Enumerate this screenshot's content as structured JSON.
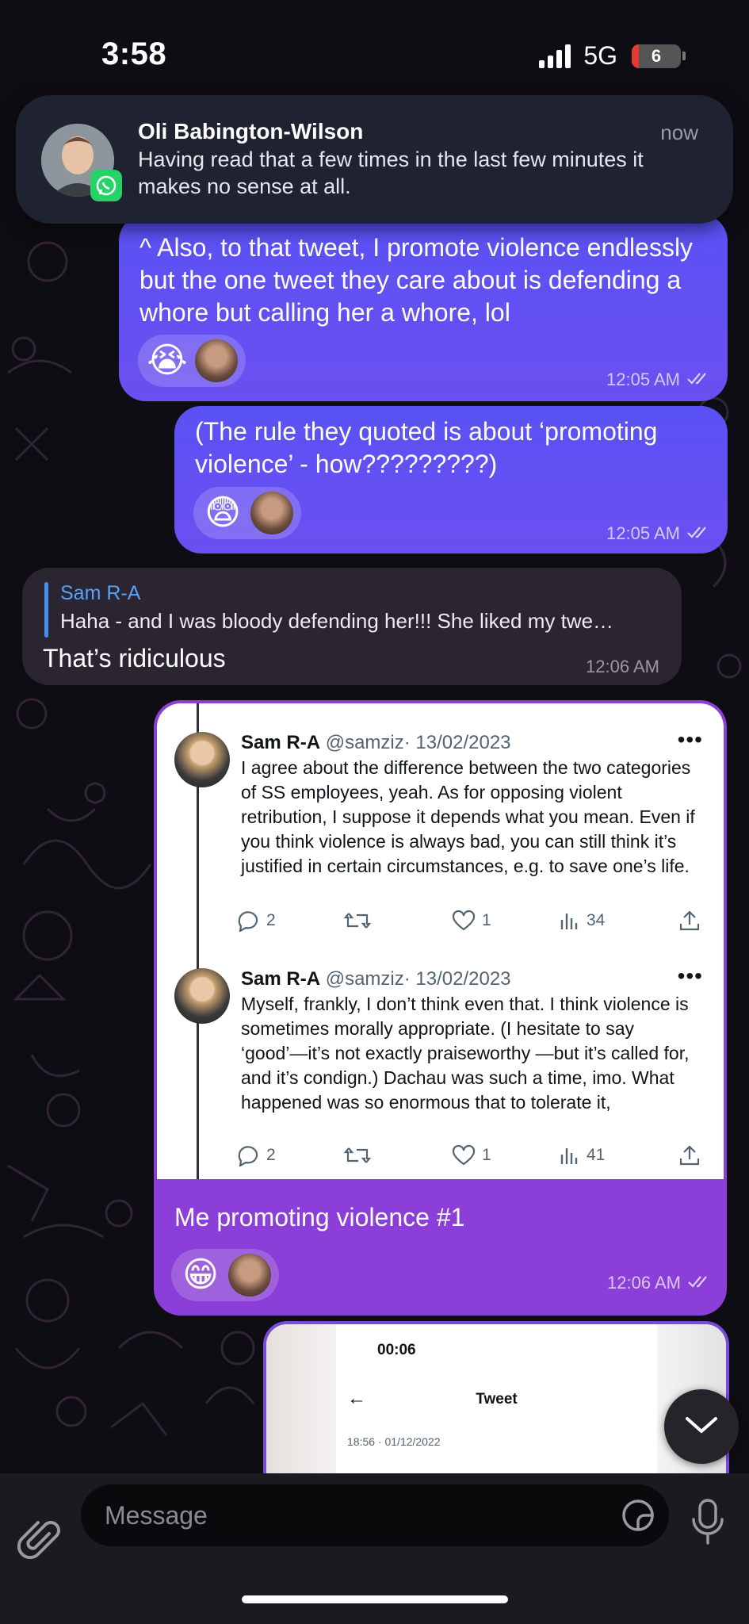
{
  "status_bar": {
    "time": "3:58",
    "network": "5G",
    "battery_percent": "6",
    "signal_bars": 4
  },
  "notification": {
    "sender": "Oli Babington-Wilson",
    "time": "now",
    "message": "Having read that a few times in the last few minutes it makes no sense at all.",
    "app_badge": "whatsapp-icon"
  },
  "messages": [
    {
      "type": "outgoing",
      "text": "^ Also, to that tweet, I promote violence endlessly but the one tweet they care about is defending a whore but calling her a whore, lol",
      "reaction": "😭",
      "time": "12:05 AM"
    },
    {
      "type": "outgoing",
      "text": "(The rule they quoted is about ‘promoting violence’ - how?????????)",
      "reaction": "😨",
      "time": "12:05 AM"
    },
    {
      "type": "incoming",
      "reply_to_name": "Sam R-A",
      "reply_to_text": "Haha - and I was bloody defending her!!! She liked my twe…",
      "text": "That’s ridiculous",
      "time": "12:06 AM"
    },
    {
      "type": "outgoing-image",
      "caption": "Me promoting violence #1",
      "reaction": "😁",
      "time": "12:06 AM",
      "tweets": [
        {
          "name": "Sam R-A",
          "handle": "@samziz",
          "date": "· 13/02/2023",
          "text": "I agree about the difference between the two categories of SS employees, yeah. As for opposing violent retribution, I suppose it depends what you mean. Even if you think violence is always bad, you can still think it’s justified in certain circumstances, e.g. to save one’s life.",
          "replies": "2",
          "likes": "1",
          "views": "34"
        },
        {
          "name": "Sam R-A",
          "handle": "@samziz",
          "date": "· 13/02/2023",
          "text": "Myself, frankly, I don’t think even that. I think violence is sometimes morally appropriate. (I hesitate to say ‘good’—it’s not exactly praiseworthy —but it’s called for, and it’s condign.) Dachau was such a time, imo. What happened was so enormous that to tolerate it,",
          "replies": "2",
          "likes": "1",
          "views": "41"
        }
      ]
    },
    {
      "type": "outgoing-image",
      "screenshot": {
        "time": "00:06",
        "title": "Tweet",
        "date": "18:56 · 01/12/2022"
      }
    }
  ],
  "composer": {
    "placeholder": "Message"
  },
  "colors": {
    "outgoing_bubble": "#5a52f5",
    "incoming_bubble": "#2a2530",
    "image_bubble": "#8b3fd8",
    "reply_accent": "#4a8cf5"
  }
}
